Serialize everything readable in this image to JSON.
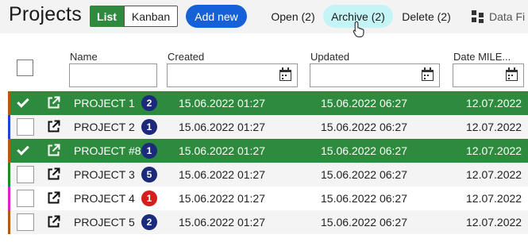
{
  "header": {
    "title": "Projects",
    "view_list": "List",
    "view_kanban": "Kanban",
    "add_new": "Add new",
    "open": "Open (2)",
    "archive": "Archive (2)",
    "delete": "Delete (2)",
    "export": "Data Fi"
  },
  "columns": {
    "name": "Name",
    "created": "Created",
    "updated": "Updated",
    "milestone": "Date MILE..."
  },
  "colors": {
    "selected_row": "#2e8b3e",
    "accent_blue": "#1761d8",
    "archive_hover": "#c5f4f6",
    "badge_navy": "#1b2a7a",
    "badge_red": "#d51f1f"
  },
  "rows": [
    {
      "name": "PROJECT 1",
      "badge": "2",
      "badge_color": "#1b2a7a",
      "created": "15.06.2022 01:27",
      "updated": "15.06.2022 06:27",
      "milestone": "12.07.2022",
      "selected": true,
      "stripe": "#b25a10"
    },
    {
      "name": "PROJECT 2",
      "badge": "1",
      "badge_color": "#1b2a7a",
      "created": "15.06.2022 01:27",
      "updated": "15.06.2022 06:27",
      "milestone": "12.07.2022",
      "selected": false,
      "stripe": "#1e44d6"
    },
    {
      "name": "PROJECT #8",
      "badge": "1",
      "badge_color": "#1b2a7a",
      "created": "15.06.2022 01:27",
      "updated": "15.06.2022 06:27",
      "milestone": "12.07.2022",
      "selected": true,
      "stripe": "#b25a10"
    },
    {
      "name": "PROJECT 3",
      "badge": "5",
      "badge_color": "#1b2a7a",
      "created": "15.06.2022 01:27",
      "updated": "15.06.2022 06:27",
      "milestone": "12.07.2022",
      "selected": false,
      "stripe": "#1b8a2a"
    },
    {
      "name": "PROJECT 4",
      "badge": "1",
      "badge_color": "#d51f1f",
      "created": "15.06.2022 01:27",
      "updated": "15.06.2022 06:27",
      "milestone": "12.07.2022",
      "selected": false,
      "stripe": "#e020c8"
    },
    {
      "name": "PROJECT 5",
      "badge": "2",
      "badge_color": "#1b2a7a",
      "created": "15.06.2022 01:27",
      "updated": "15.06.2022 06:27",
      "milestone": "12.07.2022",
      "selected": false,
      "stripe": "#b25a10"
    }
  ]
}
